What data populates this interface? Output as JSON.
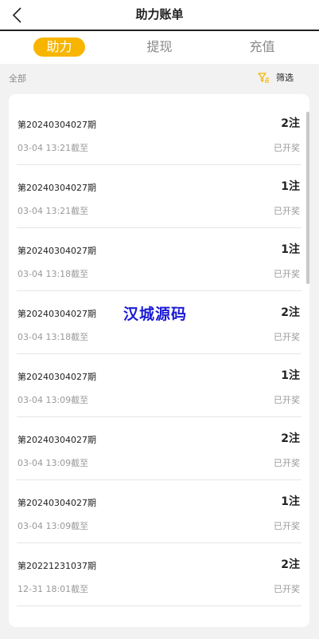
{
  "header": {
    "title": "助力账单"
  },
  "tabs": [
    {
      "label": "助力",
      "active": true
    },
    {
      "label": "提现",
      "active": false
    },
    {
      "label": "充值",
      "active": false
    }
  ],
  "filter": {
    "all_label": "全部",
    "filter_label": "筛选"
  },
  "records": [
    {
      "period": "第20240304027期",
      "deadline": "03-04 13:21截至",
      "count": "2注",
      "status": "已开奖"
    },
    {
      "period": "第20240304027期",
      "deadline": "03-04 13:21截至",
      "count": "1注",
      "status": "已开奖"
    },
    {
      "period": "第20240304027期",
      "deadline": "03-04 13:18截至",
      "count": "1注",
      "status": "已开奖"
    },
    {
      "period": "第20240304027期",
      "deadline": "03-04 13:18截至",
      "count": "2注",
      "status": "已开奖"
    },
    {
      "period": "第20240304027期",
      "deadline": "03-04 13:09截至",
      "count": "1注",
      "status": "已开奖"
    },
    {
      "period": "第20240304027期",
      "deadline": "03-04 13:09截至",
      "count": "2注",
      "status": "已开奖"
    },
    {
      "period": "第20240304027期",
      "deadline": "03-04 13:09截至",
      "count": "1注",
      "status": "已开奖"
    },
    {
      "period": "第20221231037期",
      "deadline": "12-31 18:01截至",
      "count": "2注",
      "status": "已开奖"
    }
  ],
  "watermark": "汉城源码",
  "colors": {
    "accent": "#f7b500",
    "watermark": "#1a1ad6"
  },
  "icons": {
    "back": "chevron-left-icon",
    "filter": "filter-icon"
  }
}
